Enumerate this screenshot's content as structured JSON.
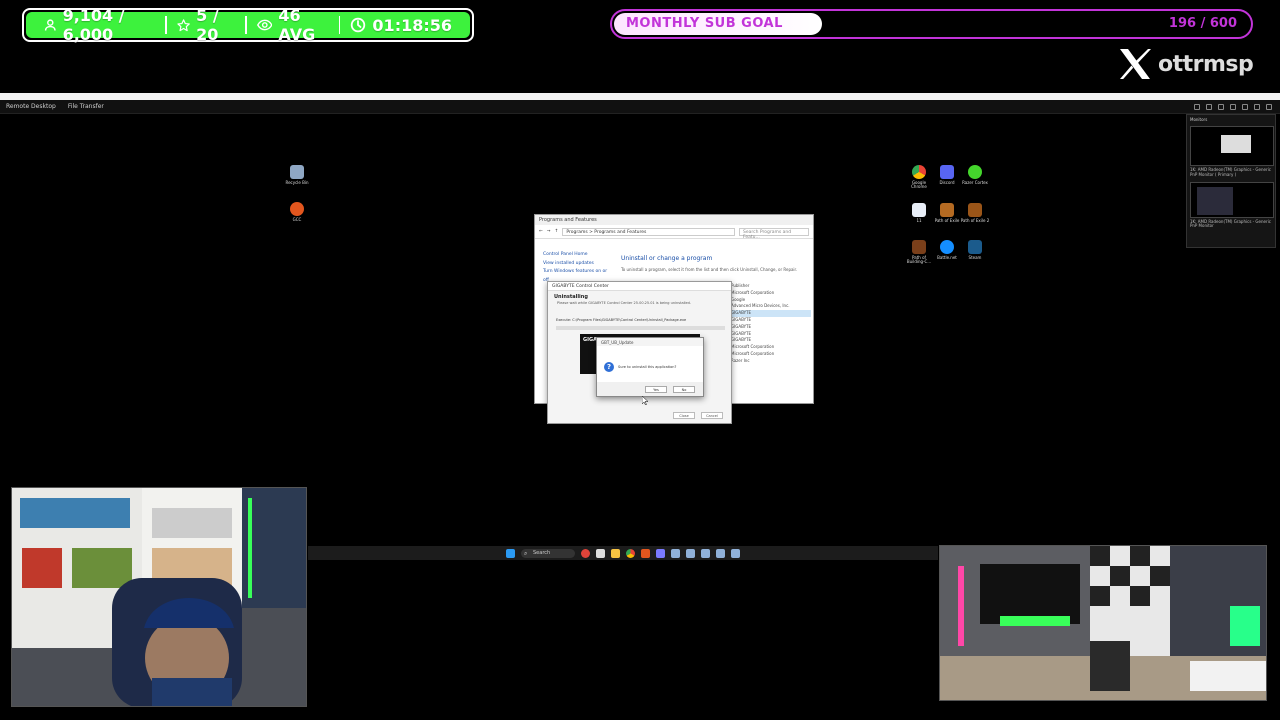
{
  "overlay": {
    "stats": {
      "followers": "9,104 / 6,000",
      "subs": "5 / 20",
      "avg_viewers": "46 AVG",
      "uptime": "01:18:56"
    },
    "goal": {
      "label": "MONTHLY SUB GOAL",
      "count": "196 / 600",
      "progress": 0.327,
      "color": "#c234d9"
    },
    "social": {
      "platform_icon": "x-logo-icon",
      "handle": "ottrmsp"
    },
    "accent": "#3df23d"
  },
  "remote_desktop": {
    "tabs": [
      "Remote Desktop",
      "File Transfer"
    ],
    "desktop_icons_left": [
      "Recycle Bin",
      "GCC"
    ],
    "desktop_icons_right": [
      "Google Chrome",
      "Discord",
      "Razer Cortex",
      "11",
      "Path of Exile",
      "Path of Exile 2",
      "Path of Building-C...",
      "Battle.net",
      "Steam"
    ],
    "monitors": {
      "title": "Monitors",
      "items": [
        "1K: AMD Radeon(TM) Graphics - Generic PnP Monitor ( Primary )",
        "1K: AMD Radeon(TM) Graphics - Generic PnP Monitor"
      ]
    }
  },
  "programs_window": {
    "title": "Programs and Features",
    "address": "Programs  >  Programs and Features",
    "search_placeholder": "Search Programs and Featu...",
    "left_links": [
      "Control Panel Home",
      "View installed updates",
      "Turn Windows features on or off"
    ],
    "heading": "Uninstall or change a program",
    "subtext": "To uninstall a program, select it from the list and then click Uninstall, Change, or Repair.",
    "list": [
      "Publisher",
      "Microsoft Corporation",
      "Google",
      "Advanced Micro Devices, Inc.",
      "GIGABYTE",
      "GIGABYTE",
      "GIGABYTE",
      "GIGABYTE",
      "GIGABYTE",
      "Microsoft Corporation",
      "Microsoft Corporation",
      "Razer Inc"
    ]
  },
  "uninstaller": {
    "title": "GIGABYTE Control Center",
    "heading": "Uninstalling",
    "status": "Please wait while GIGABYTE Control Center 25.00.25.01 is being uninstalled.",
    "path": "Execute: C:\\Program Files\\GIGABYTE\\Control Center\\Uninstall_Package.exe",
    "dark_label": "GIGA",
    "buttons": [
      "Close",
      "Cancel"
    ]
  },
  "confirm_dialog": {
    "title": "GBT_UB_Update",
    "message": "Sure to uninstall this application?",
    "buttons": [
      "Yes",
      "No"
    ]
  },
  "taskbar": {
    "search_label": "Search"
  }
}
